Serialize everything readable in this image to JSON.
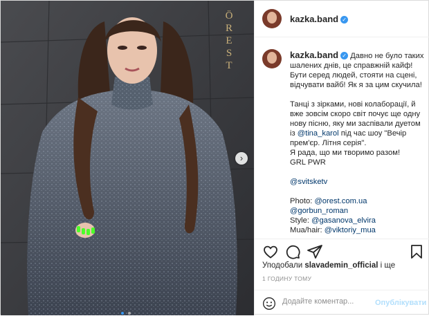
{
  "photo": {
    "watermark": "ÖREST",
    "next_icon": "chevron-right-icon",
    "carousel_dots": 2,
    "active_dot": 0,
    "colors": {
      "background": "#3a3b3f",
      "hair": "#3b261b",
      "dress": "#5c6470",
      "skin": "#e8c3ad",
      "nails": "#4cff2a"
    }
  },
  "header": {
    "username": "kazka.band",
    "verified_icon": "verified-badge-icon"
  },
  "caption": {
    "username": "kazka.band",
    "line1": "Давно не було таких шалених днів, це справжній кайф! Бути серед людей, стояти на сцені, відчувати вайб! Як я за цим скучила!",
    "p2_before": "Танці з зірками, нові колаборації, й вже зовсім скоро світ почує ще одну нову пісню, яку ми заспівали дуетом із ",
    "p2_mention": "@tina_karol",
    "p2_after": " під час шоу \"Вечір прем'єр. Літня серія\".",
    "p3": "Я рада, що ми творимо разом!",
    "p4": "GRL PWR",
    "tag": "@svitsketv",
    "photo_label": "Photo: ",
    "photo_tag1": "@orest.com.ua",
    "photo_tag2": "@gorbun_roman",
    "style_label": "Style: ",
    "style_tag": "@gasanova_elvira",
    "mua_label": "Mua/hair: ",
    "mua_tag": "@viktoriy_mua"
  },
  "actions": {
    "icons": [
      "heart-icon",
      "comment-icon",
      "share-icon",
      "bookmark-icon"
    ]
  },
  "likes": {
    "prefix": "Уподобали ",
    "user": "slavademin_official",
    "suffix": " і ще"
  },
  "time": "1 ГОДИНУ ТОМУ",
  "comment": {
    "placeholder": "Додайте коментар...",
    "publish_label": "Опублікувати"
  }
}
